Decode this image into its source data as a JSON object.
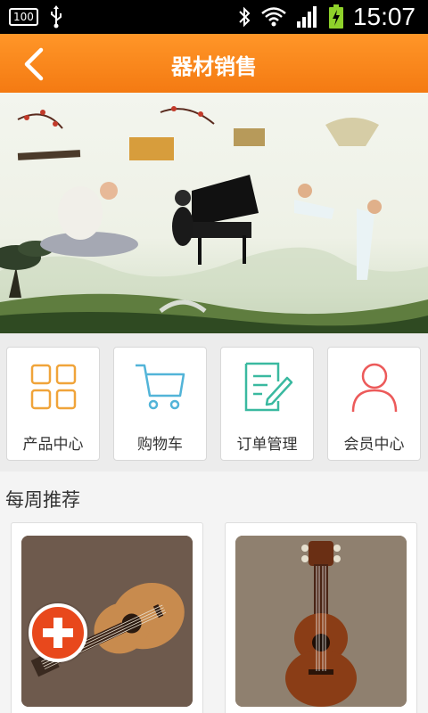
{
  "status_bar": {
    "battery_pct": "100",
    "time": "15:07"
  },
  "header": {
    "title": "器材销售",
    "back_icon": "chevron-left-icon"
  },
  "banner": {
    "slides_total": 5,
    "active_slide": 3,
    "illustration": "musical-instruments-yoga-piano-martial-arts"
  },
  "menu": {
    "items": [
      {
        "label": "产品中心",
        "icon": "grid-icon"
      },
      {
        "label": "购物车",
        "icon": "cart-icon"
      },
      {
        "label": "订单管理",
        "icon": "edit-note-icon"
      },
      {
        "label": "会员中心",
        "icon": "user-icon"
      }
    ]
  },
  "weekly": {
    "title": "每周推荐",
    "products": [
      {
        "name": "",
        "image": "ukulele-light-brown"
      },
      {
        "name": "",
        "image": "ukulele-dark-brown"
      }
    ],
    "add_icon": "plus-icon"
  },
  "colors": {
    "header_orange": "#f58a1f",
    "menu_icon_orange": "#f0a43a",
    "menu_icon_blue": "#52b4d8",
    "menu_icon_green": "#3ab9a0",
    "menu_icon_red": "#ec5a5a",
    "add_button": "#e8481c"
  }
}
